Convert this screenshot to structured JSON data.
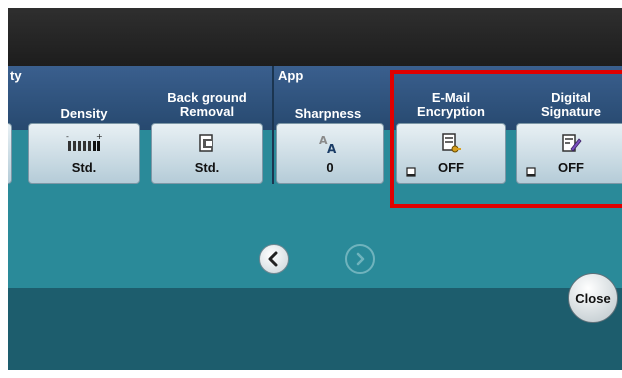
{
  "groups": {
    "quality_partial": "ty",
    "application": "App"
  },
  "buttons": [
    {
      "title": "",
      "value": ""
    },
    {
      "title": "Density",
      "value": "Std.",
      "icon": "density-scale-icon"
    },
    {
      "title": "Background\nRemoval",
      "value": "Std.",
      "icon": "background-removal-icon"
    },
    {
      "title": "Sharpness",
      "value": "0",
      "icon": "sharpness-icon"
    },
    {
      "title": "E-Mail\nEncryption",
      "value": "OFF",
      "icon": "email-encryption-icon",
      "locked": true
    },
    {
      "title": "Digital\nSignature",
      "value": "OFF",
      "icon": "digital-signature-icon",
      "locked": true
    }
  ],
  "pager": {
    "prev_icon": "chevron-left-icon",
    "next_icon": "chevron-right-icon"
  },
  "close_label": "Close",
  "colors": {
    "highlight": "#e00000",
    "panel": "#2a8a99",
    "tab_band": "#2f5784"
  }
}
